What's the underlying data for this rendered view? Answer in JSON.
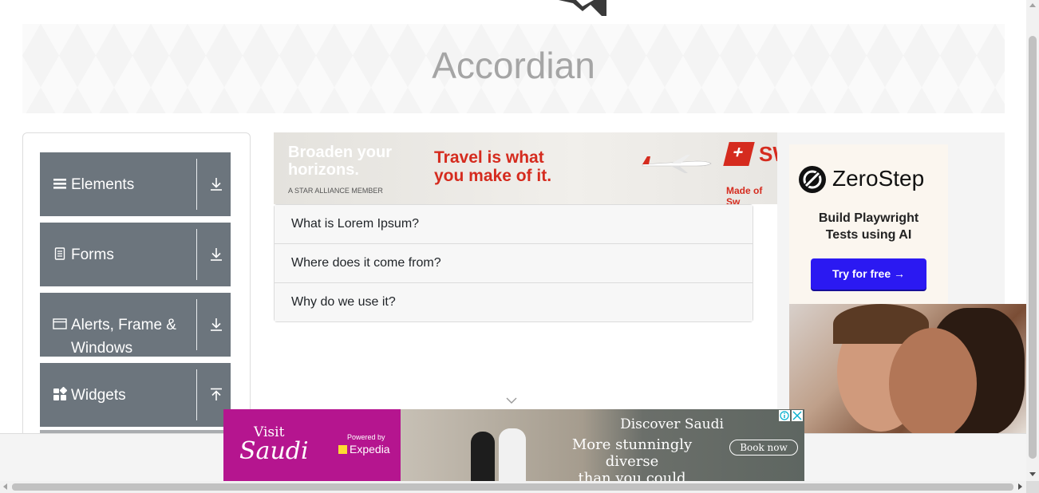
{
  "page": {
    "title": "Accordian"
  },
  "sidebar": {
    "groups": [
      {
        "label": "Elements",
        "icon": "hamburger-icon",
        "arrow": "download-arrow-icon"
      },
      {
        "label": "Forms",
        "icon": "document-icon",
        "arrow": "download-arrow-icon"
      },
      {
        "label": "Alerts, Frame & Windows",
        "icon": "window-icon",
        "arrow": "download-arrow-icon"
      },
      {
        "label": "Widgets",
        "icon": "widgets-icon",
        "arrow": "upload-arrow-icon"
      }
    ]
  },
  "accordion": {
    "sections": [
      {
        "heading": "What is Lorem Ipsum?"
      },
      {
        "heading": "Where does it come from?"
      },
      {
        "heading": "Why do we use it?"
      }
    ]
  },
  "ads": {
    "top": {
      "line1": "Broaden your",
      "line2": "horizons.",
      "member": "A STAR ALLIANCE MEMBER",
      "slogan1": "Travel is what",
      "slogan2": "you make of it.",
      "brand_partial": "SW",
      "made_of": "Made of Sw",
      "brand_color": "#d52b1e"
    },
    "zerostep": {
      "brand": "ZeroStep",
      "tagline1": "Build Playwright",
      "tagline2": "Tests using AI",
      "cta": "Try for free →",
      "cta_color": "#2b19f2"
    },
    "bottom": {
      "visit": "Visit",
      "saudi": "Saudi",
      "powered_by": "Powered by",
      "partner": "Expedia",
      "headline": "Discover Saudi",
      "sub1": "More stunningly diverse",
      "sub2": "than you could imagine",
      "cta": "Book now",
      "bg_color": "#b5158f"
    }
  }
}
